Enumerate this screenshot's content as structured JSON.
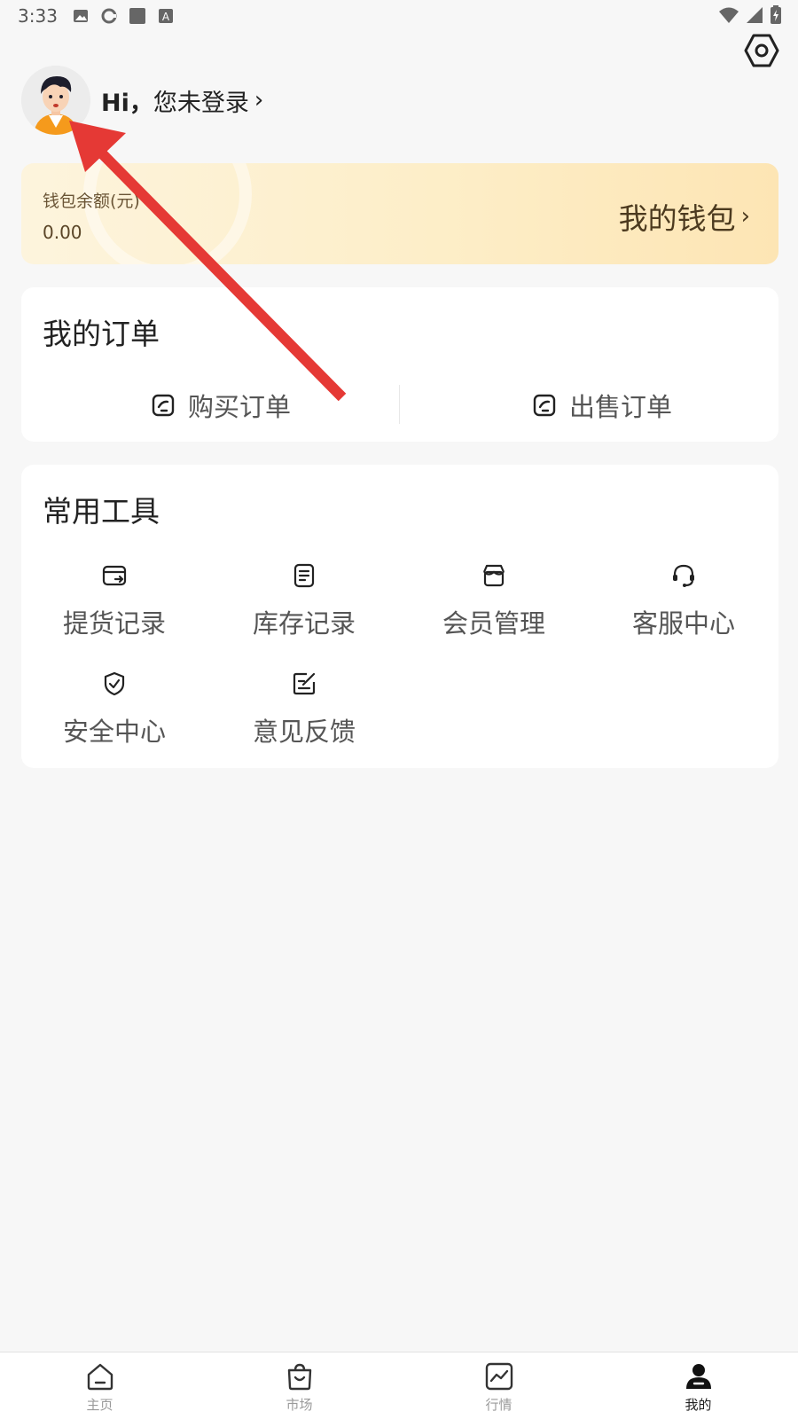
{
  "status_bar": {
    "time": "3:33"
  },
  "profile": {
    "greeting_hi": "Hi，",
    "greeting_text": "您未登录",
    "chevron": "›"
  },
  "wallet": {
    "label": "钱包余额(元)",
    "balance": "0.00",
    "link_text": "我的钱包",
    "chevron": "›"
  },
  "orders": {
    "title": "我的订单",
    "buy_label": "购买订单",
    "sell_label": "出售订单"
  },
  "tools": {
    "title": "常用工具",
    "items": [
      {
        "label": "提货记录",
        "icon": "delivery-icon"
      },
      {
        "label": "库存记录",
        "icon": "document-icon"
      },
      {
        "label": "会员管理",
        "icon": "store-icon"
      },
      {
        "label": "客服中心",
        "icon": "headset-icon"
      },
      {
        "label": "安全中心",
        "icon": "shield-icon"
      },
      {
        "label": "意见反馈",
        "icon": "edit-icon"
      }
    ]
  },
  "tabbar": {
    "items": [
      {
        "label": "主页",
        "icon": "home-icon",
        "active": false
      },
      {
        "label": "市场",
        "icon": "bag-icon",
        "active": false
      },
      {
        "label": "行情",
        "icon": "chart-icon",
        "active": false
      },
      {
        "label": "我的",
        "icon": "user-icon",
        "active": true
      }
    ]
  },
  "colors": {
    "background": "#f7f7f7",
    "wallet_gradient_start": "#fdf4dd",
    "wallet_gradient_end": "#fde5b4",
    "annotation_arrow": "#e53935"
  }
}
